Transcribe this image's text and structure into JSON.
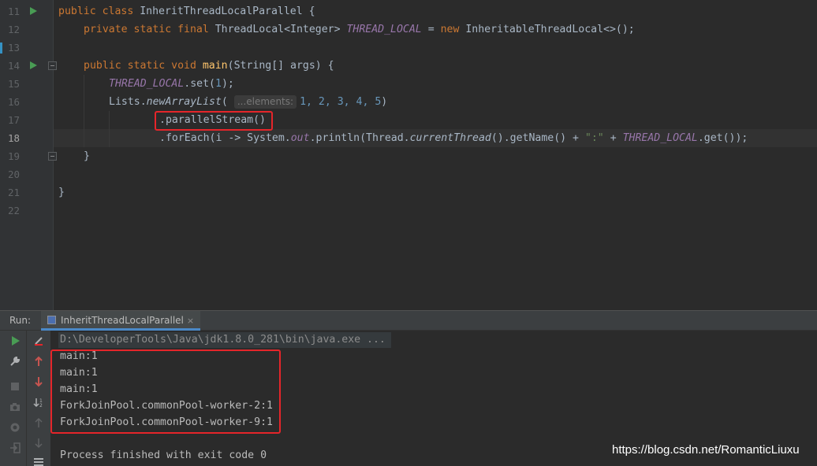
{
  "editor": {
    "line_numbers": [
      "11",
      "12",
      "13",
      "14",
      "15",
      "16",
      "17",
      "18",
      "19",
      "20",
      "21",
      "22"
    ],
    "lines": {
      "l11": {
        "kw": "public class ",
        "name": "InheritThreadLocalParallel {"
      },
      "l12": {
        "kw": "private static final ",
        "type": "ThreadLocal<Integer> ",
        "field": "THREAD_LOCAL",
        "eq": " = ",
        "newkw": "new ",
        "ctor": "InheritableThreadLocal<>();"
      },
      "l14": {
        "kw": "public static void ",
        "method": "main",
        "rest": "(String[] args) {"
      },
      "l15": {
        "field": "THREAD_LOCAL",
        "call": ".set(",
        "num": "1",
        "end": ");"
      },
      "l16": {
        "cls": "Lists.",
        "method": "newArrayList",
        "paren": "(",
        "hint": "...elements:",
        "args": "1, 2, 3, 4, 5",
        "end": ")"
      },
      "l17": {
        "text": ".parallelStream()"
      },
      "l18": {
        "a": ".forEach(i -> System.",
        "out": "out",
        "b": ".println(Thread.",
        "ct": "currentThread",
        "c": "().getName() + ",
        "str": "\":\"",
        "d": " + ",
        "field": "THREAD_LOCAL",
        "e": ".get());"
      },
      "l19": {
        "text": "}"
      },
      "l21": {
        "text": "}"
      }
    }
  },
  "run_panel": {
    "label": "Run:",
    "tab_title": "InheritThreadLocalParallel",
    "tab_close": "×"
  },
  "console": {
    "command": "D:\\DeveloperTools\\Java\\jdk1.8.0_281\\bin\\java.exe ...",
    "output": [
      "main:1",
      "main:1",
      "main:1",
      "ForkJoinPool.commonPool-worker-2:1",
      "ForkJoinPool.commonPool-worker-9:1"
    ],
    "exit_message": "Process finished with exit code 0"
  },
  "watermark": "https://blog.csdn.net/RomanticLiuxu",
  "colors": {
    "highlight_box": "#e5252a",
    "keyword": "#cc7832",
    "number": "#6897bb",
    "static_field": "#9876aa",
    "method": "#ffc66d",
    "string": "#6a8759"
  }
}
